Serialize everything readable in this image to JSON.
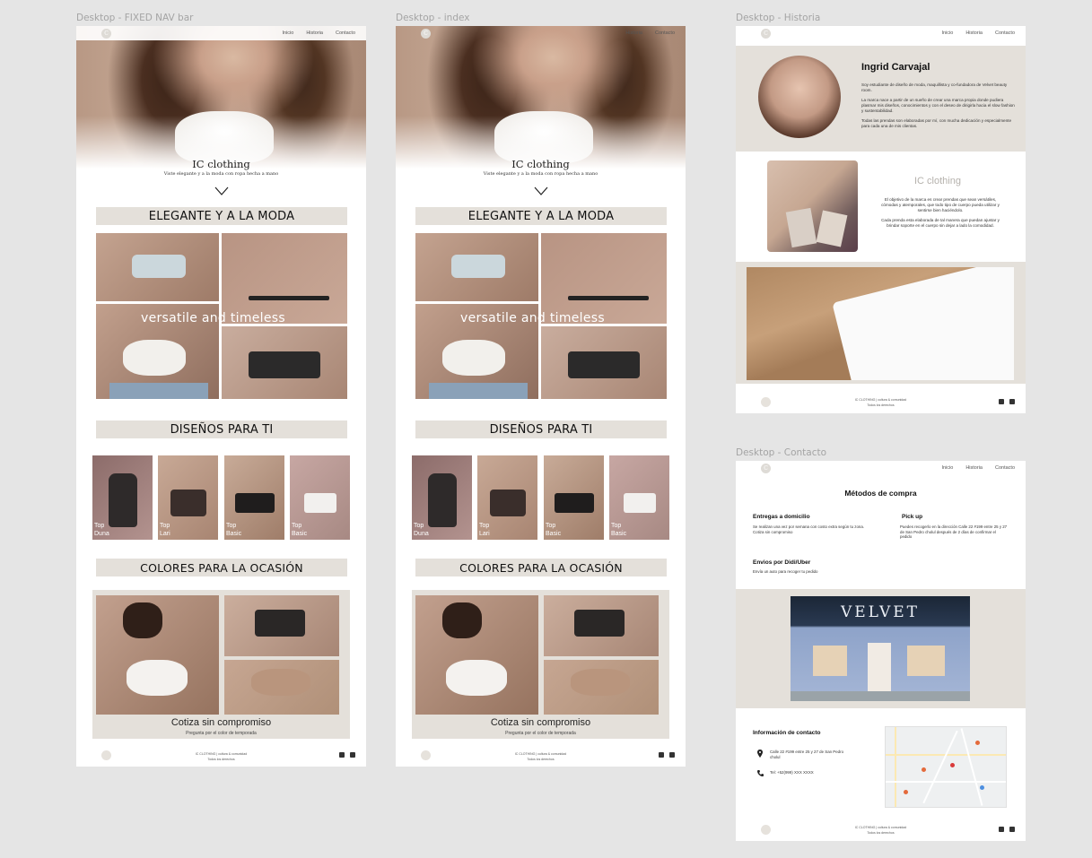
{
  "frames": {
    "fixed_nav": {
      "label": "Desktop - FIXED NAV bar"
    },
    "index": {
      "label": "Desktop - index"
    },
    "historia": {
      "label": "Desktop - Historia"
    },
    "contacto": {
      "label": "Desktop - Contacto"
    }
  },
  "nav": {
    "inicio": "Inicio",
    "historia": "Historia",
    "contacto": "Contacto"
  },
  "hero": {
    "title": "IC clothing",
    "subtitle": "Viste elegante y a la moda con ropa hecha a mano"
  },
  "sections": {
    "elegante": "ELEGANTE Y A LA MODA",
    "overlay": "versatile and timeless",
    "disenos": "DISEÑOS PARA TI",
    "colores": "COLORES PARA LA OCASIÓN",
    "cotiza": "Cotiza sin compromiso",
    "cotiza_sub": "Pregunta por el color de temporada"
  },
  "products": [
    {
      "line1": "Top",
      "line2": "Duna"
    },
    {
      "line1": "Top",
      "line2": "Lari"
    },
    {
      "line1": "Top",
      "line2": "Basic"
    },
    {
      "line1": "Top",
      "line2": "Basic"
    }
  ],
  "footer": {
    "line1": "IC CLOTHING | cultura & comunidad",
    "line2": "Todos los derechos"
  },
  "historia": {
    "name": "Ingrid Carvajal",
    "bio1": "Soy estudiante de diseño de moda, maquillista y co-fundadora de Velvet beauty room.",
    "bio2": "La marca nace a partir de un sueño de crear una marca propia donde pudiera plasmar mis diseños, conocimientos y con el deseo de dirigirla hacia el slow fashion y sustentabilidad.",
    "bio3": "Todas las prendas son elaboradas por mí, con mucha dedicación y especialmente para cada una de mis clientas.",
    "brand": "IC clothing",
    "brand_p1": "El objetivo de la marca es crear prendas que sean versátiles, cómodas y atemporales, que todo tipo de cuerpo pueda utilizar y sentirse bien haciéndolo.",
    "brand_p2": "Cada prenda esta elaborada de tal manera que puedan ajustar y brindar soporte en el cuerpo sin dejar a lado la comodidad."
  },
  "contacto": {
    "title": "Métodos de compra",
    "entregas_title": "Entregas a domicilio",
    "entregas_text": "Se realizan una vez por semana con costo extra según tu zona.",
    "entregas_text2": "Cotiza sin compromiso",
    "pickup_title": "Pick up",
    "pickup_text": "Puedes recogerlo en la dirección Calle 22 #199 entre 25 y 27 de San Pedro cholul después de 2 días de confirmar el pedido",
    "envios_title": "Envios por Didi/Uber",
    "envios_text": "Envía un auto para recoger tu pedido",
    "store_sign": "VELVET",
    "info_title": "Información de contacto",
    "address": "Calle 22 #199 entre 25 y 27 de San Pedro cholul",
    "tel": "Tel:   +52(999) XXX XXXX"
  },
  "colors": {
    "band": "#e4e0da",
    "canvas": "#e5e5e5"
  }
}
